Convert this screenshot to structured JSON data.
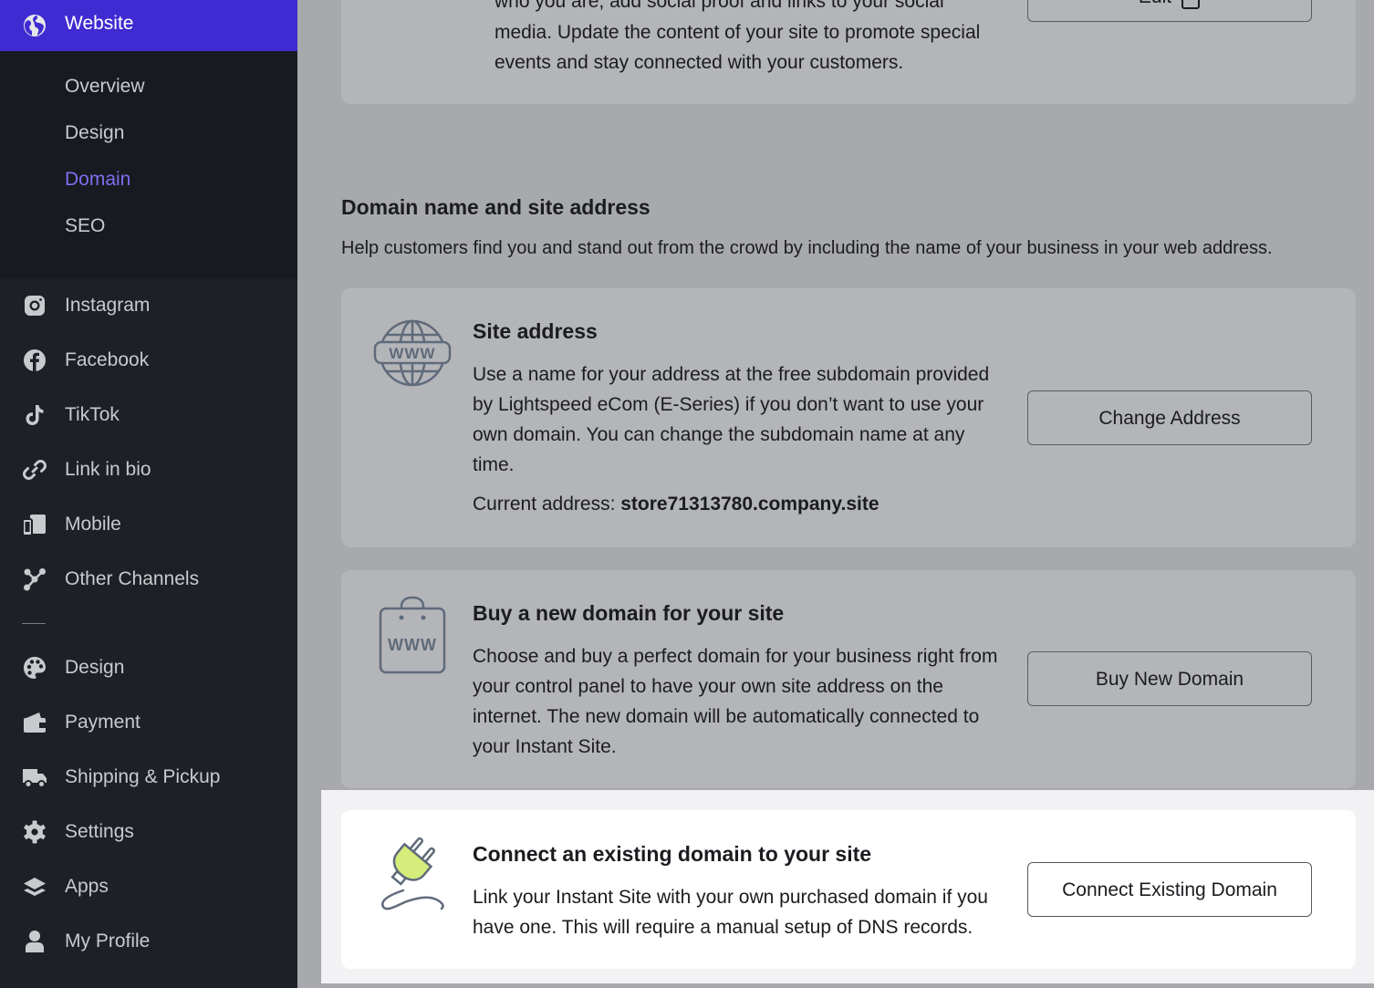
{
  "sidebar": {
    "active": {
      "label": "Website",
      "icon": "globe-icon"
    },
    "sub_items": [
      {
        "label": "Overview",
        "active": false
      },
      {
        "label": "Design",
        "active": false
      },
      {
        "label": "Domain",
        "active": true
      },
      {
        "label": "SEO",
        "active": false
      }
    ],
    "items": [
      {
        "label": "Instagram",
        "icon": "instagram-icon"
      },
      {
        "label": "Facebook",
        "icon": "facebook-icon"
      },
      {
        "label": "TikTok",
        "icon": "tiktok-icon"
      },
      {
        "label": "Link in bio",
        "icon": "link-icon"
      },
      {
        "label": "Mobile",
        "icon": "mobile-icon"
      },
      {
        "label": "Other Channels",
        "icon": "channels-icon"
      },
      {
        "label": "Design",
        "icon": "palette-icon"
      },
      {
        "label": "Payment",
        "icon": "wallet-icon"
      },
      {
        "label": "Shipping & Pickup",
        "icon": "truck-icon"
      },
      {
        "label": "Settings",
        "icon": "gear-icon"
      },
      {
        "label": "Apps",
        "icon": "layers-icon"
      },
      {
        "label": "My Profile",
        "icon": "person-icon"
      }
    ]
  },
  "top_card": {
    "text_line1": "who you are, add social proof and links to your social",
    "text_line2": "media. Update the content of your site to promote special",
    "text_line3": "events and stay connected with your customers.",
    "button_label": "Edit"
  },
  "section": {
    "title": "Domain name and site address",
    "description": "Help customers find you and stand out from the crowd by including the name of your business in your web address."
  },
  "site_address": {
    "title": "Site address",
    "text": "Use a name for your address at the free subdomain provided by Lightspeed eCom (E-Series) if you don’t want to use your own domain. You can change the subdomain name at any time.",
    "current_label": "Current address:",
    "current_value": "store71313780.company.site",
    "button_label": "Change Address",
    "icon": "www-globe-icon"
  },
  "buy_domain": {
    "title": "Buy a new domain for your site",
    "text": "Choose and buy a perfect domain for your business right from your control panel to have your own site address on the internet. The new domain will be automatically connected to your Instant Site.",
    "button_label": "Buy New Domain",
    "icon": "www-bag-icon"
  },
  "connect_domain": {
    "title": "Connect an existing domain to your site",
    "text": "Link your Instant Site with your own purchased domain if you have one. This will require a manual setup of DNS records.",
    "button_label": "Connect Existing Domain",
    "icon": "plug-icon",
    "accent": "#d6ec7b"
  },
  "colors": {
    "sidebar_bg": "#1d2026",
    "sidebar_active": "#3f2bd1",
    "sub_active": "#7e6ef0"
  }
}
